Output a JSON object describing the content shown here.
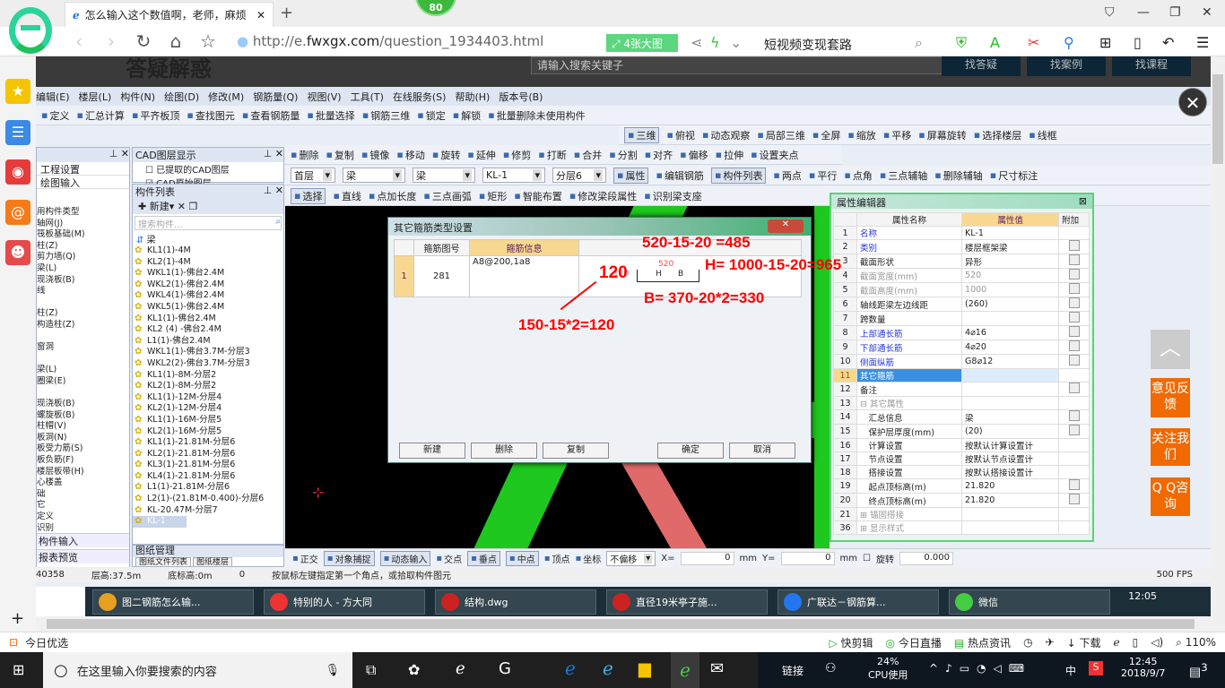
{
  "browser": {
    "tab_title": "怎么输入这个数值啊，老师，麻烦",
    "badge": "80",
    "url_prefix": "http://e.",
    "url_domain": "fwxgx.com",
    "url_path": "/question_1934403.html",
    "big_image_btn": "4张大图",
    "search_text": "短视频变现套路",
    "zoom": "110%"
  },
  "website": {
    "title": "答疑解惑",
    "search_placeholder": "请输入搜索关键子",
    "nav": [
      "找答疑",
      "找案例",
      "找课程"
    ]
  },
  "app": {
    "menu": [
      "编辑(E)",
      "楼层(L)",
      "构件(N)",
      "绘图(D)",
      "修改(M)",
      "钢筋量(Q)",
      "视图(V)",
      "工具(T)",
      "在线服务(S)",
      "帮助(H)",
      "版本号(B)"
    ],
    "toolbar1": [
      "定义",
      "汇总计算",
      "平齐板顶",
      "查找图元",
      "查看钢筋量",
      "批量选择",
      "钢筋三维",
      "锁定",
      "解锁",
      "批量删除未使用构件"
    ],
    "toolbar2": [
      "三维",
      "俯视",
      "动态观察",
      "局部三维",
      "全屏",
      "缩放",
      "平移",
      "屏幕旋转",
      "选择楼层",
      "线框"
    ],
    "toolbar3": [
      "删除",
      "复制",
      "镜像",
      "移动",
      "旋转",
      "延伸",
      "修剪",
      "打断",
      "合并",
      "分割",
      "对齐",
      "偏移",
      "拉伸",
      "设置夹点"
    ],
    "selectors": [
      "首层",
      "梁",
      "梁",
      "KL-1",
      "分层6"
    ],
    "toolbar4": [
      "属性",
      "编辑钢筋",
      "构件列表",
      "两点",
      "平行",
      "点角",
      "三点辅轴",
      "删除辅轴",
      "尺寸标注"
    ],
    "toolbar5": [
      "选择",
      "直线",
      "点加长度",
      "三点画弧",
      "矩形",
      "智能布置",
      "修改梁段属性",
      "识别梁支座"
    ],
    "left_panel": {
      "tabs": [
        "工程设置",
        "绘图输入"
      ],
      "tree": [
        "用构件类型",
        "轴网(J)",
        "筏板基础(M)",
        "柱(Z)",
        "剪力墙(Q)",
        "梁(L)",
        "现浇板(B)",
        "线",
        "",
        "柱(Z)",
        "构造柱(Z)",
        "",
        "窗洞",
        "",
        "梁(L)",
        "圈梁(E)",
        "",
        "现浇板(B)",
        "螺旋板(B)",
        "柱帽(V)",
        "板洞(N)",
        "板受力筋(S)",
        "板负筋(F)",
        "楼层板带(H)",
        "心楼盖",
        "础",
        "它",
        "定义",
        "识别"
      ],
      "bottom": [
        "构件输入",
        "报表预览"
      ]
    },
    "cad_panel": {
      "title": "CAD图层显示",
      "items": [
        "已提取的CAD图层",
        "CAD原始图层"
      ]
    },
    "component_panel": {
      "title": "构件列表",
      "new": "新建",
      "search_placeholder": "搜索构件...",
      "root": "梁",
      "items": [
        "KL1(1)-4M",
        "KL2(1)-4M",
        "WKL1(1)-佛台2.4M",
        "WKL2(1)-佛台2.4M",
        "WKL4(1)-佛台2.4M",
        "WKL5(1)-佛台2.4M",
        "KL1(1)-佛台2.4M",
        "KL2 (4) -佛台2.4M",
        "L1(1)-佛台2.4M",
        "WKL1(1)-佛台3.7M-分层3",
        "WKL2(2)-佛台3.7M-分层3",
        "KL1(1)-8M-分层2",
        "KL2(1)-8M-分层2",
        "KL1(1)-12M-分层4",
        "KL2(1)-12M-分层4",
        "KL1(1)-16M-分层5",
        "KL2(1)-16M-分层5",
        "KL1(1)-21.81M-分层6",
        "KL2(1)-21.81M-分层6",
        "KL3(1)-21.81M-分层6",
        "KL4(1)-21.81M-分层6",
        "L1(1)-21.81M-分层6",
        "L2(1)-(21.81M-0.400)-分层6",
        "KL-20.47M-分层7",
        "KL-1"
      ],
      "drawing_title": "图纸管理",
      "drawing_tabs": [
        "图纸文件列表",
        "图纸楼层"
      ]
    },
    "dialog": {
      "title": "其它箍筋类型设置",
      "headers": [
        "箍筋图号",
        "箍筋信息",
        "图形"
      ],
      "row": {
        "index": "1",
        "code": "281",
        "info": "A8@200,1a8",
        "dim_top": "520",
        "label_h": "H",
        "label_b": "B",
        "left_dim": "120"
      },
      "buttons": [
        "新建",
        "删除",
        "复制",
        "确定",
        "取消"
      ]
    },
    "annotations": [
      "520-15-20 =485",
      "H=  1000-15-20=965",
      "120",
      "B=  370-20*2=330",
      "150-15*2=120"
    ],
    "property_editor": {
      "title": "属性编辑器",
      "headers": [
        "属性名称",
        "属性值",
        "附加"
      ],
      "rows": [
        {
          "n": "1",
          "name": "名称",
          "val": "KL-1",
          "style": "blue",
          "cb": false
        },
        {
          "n": "2",
          "name": "类别",
          "val": "楼层框架梁",
          "style": "blue",
          "cb": true
        },
        {
          "n": "3",
          "name": "截面形状",
          "val": "异形",
          "style": "",
          "cb": true
        },
        {
          "n": "4",
          "name": "截面宽度(mm)",
          "val": "520",
          "style": "gray",
          "cb": true
        },
        {
          "n": "5",
          "name": "截面高度(mm)",
          "val": "1000",
          "style": "gray",
          "cb": true
        },
        {
          "n": "6",
          "name": "轴线距梁左边线距",
          "val": "(260)",
          "style": "",
          "cb": true
        },
        {
          "n": "7",
          "name": "跨数量",
          "val": "",
          "style": "",
          "cb": true
        },
        {
          "n": "8",
          "name": "上部通长筋",
          "val": "4⌀16",
          "style": "blue",
          "cb": true
        },
        {
          "n": "9",
          "name": "下部通长筋",
          "val": "4⌀20",
          "style": "blue",
          "cb": true
        },
        {
          "n": "10",
          "name": "侧面纵筋",
          "val": "G8⌀12",
          "style": "blue",
          "cb": true
        },
        {
          "n": "11",
          "name": "其它箍筋",
          "val": "",
          "style": "hl",
          "cb": false
        },
        {
          "n": "12",
          "name": "备注",
          "val": "",
          "style": "",
          "cb": true
        },
        {
          "n": "13",
          "name": "⊟ 其它属性",
          "val": "",
          "style": "gray",
          "cb": false
        },
        {
          "n": "14",
          "name": "　汇总信息",
          "val": "梁",
          "style": "",
          "cb": true
        },
        {
          "n": "15",
          "name": "　保护层厚度(mm)",
          "val": "(20)",
          "style": "",
          "cb": true
        },
        {
          "n": "16",
          "name": "　计算设置",
          "val": "按默认计算设置计",
          "style": "",
          "cb": false
        },
        {
          "n": "17",
          "name": "　节点设置",
          "val": "按默认节点设置计",
          "style": "",
          "cb": false
        },
        {
          "n": "18",
          "name": "　搭接设置",
          "val": "按默认搭接设置计",
          "style": "",
          "cb": false
        },
        {
          "n": "19",
          "name": "　起点顶标高(m)",
          "val": "21.820",
          "style": "",
          "cb": true
        },
        {
          "n": "20",
          "name": "　终点顶标高(m)",
          "val": "21.820",
          "style": "",
          "cb": true
        },
        {
          "n": "21",
          "name": "⊞ 锚固搭接",
          "val": "",
          "style": "gray",
          "cb": false
        },
        {
          "n": "36",
          "name": "⊞ 显示样式",
          "val": "",
          "style": "gray",
          "cb": false
        }
      ]
    },
    "snap_bar": {
      "items": [
        "正交",
        "对象捕捉",
        "动态输入",
        "交点",
        "垂点",
        "中点",
        "顶点",
        "坐标"
      ],
      "offset": "不偏移",
      "x_label": "X=",
      "x": "0",
      "y_label": "Y=",
      "y": "0",
      "unit": "mm",
      "rotate": "旋转",
      "rotate_val": "0.000"
    },
    "status": {
      "coord": "40358",
      "floor_h": "层高:37.5m",
      "bottom_h": "底标高:0m",
      "zero": "0",
      "hint": "按鼠标左键指定第一个角点，或拾取构件图元",
      "fps": "500 FPS"
    }
  },
  "inner_taskbar": {
    "items": [
      "图二钢筋怎么输...",
      "特别的人 - 方大同",
      "结构.dwg",
      "直径19米亭子施...",
      "广联达－钢筋算...",
      "微信"
    ],
    "time": "12:05"
  },
  "float_buttons": [
    "意见反馈",
    "关注我们",
    "Q Q咨询"
  ],
  "browser_status": {
    "left": "今日优选",
    "items": [
      "快剪辑",
      "今日直播",
      "热点资讯",
      "下载"
    ]
  },
  "taskbar": {
    "search": "在这里输入你要搜索的内容",
    "link": "链接",
    "cpu": "24%",
    "cpu_label": "CPU使用",
    "ime": "中",
    "time": "12:45",
    "date": "2018/9/7",
    "notif": "3"
  }
}
